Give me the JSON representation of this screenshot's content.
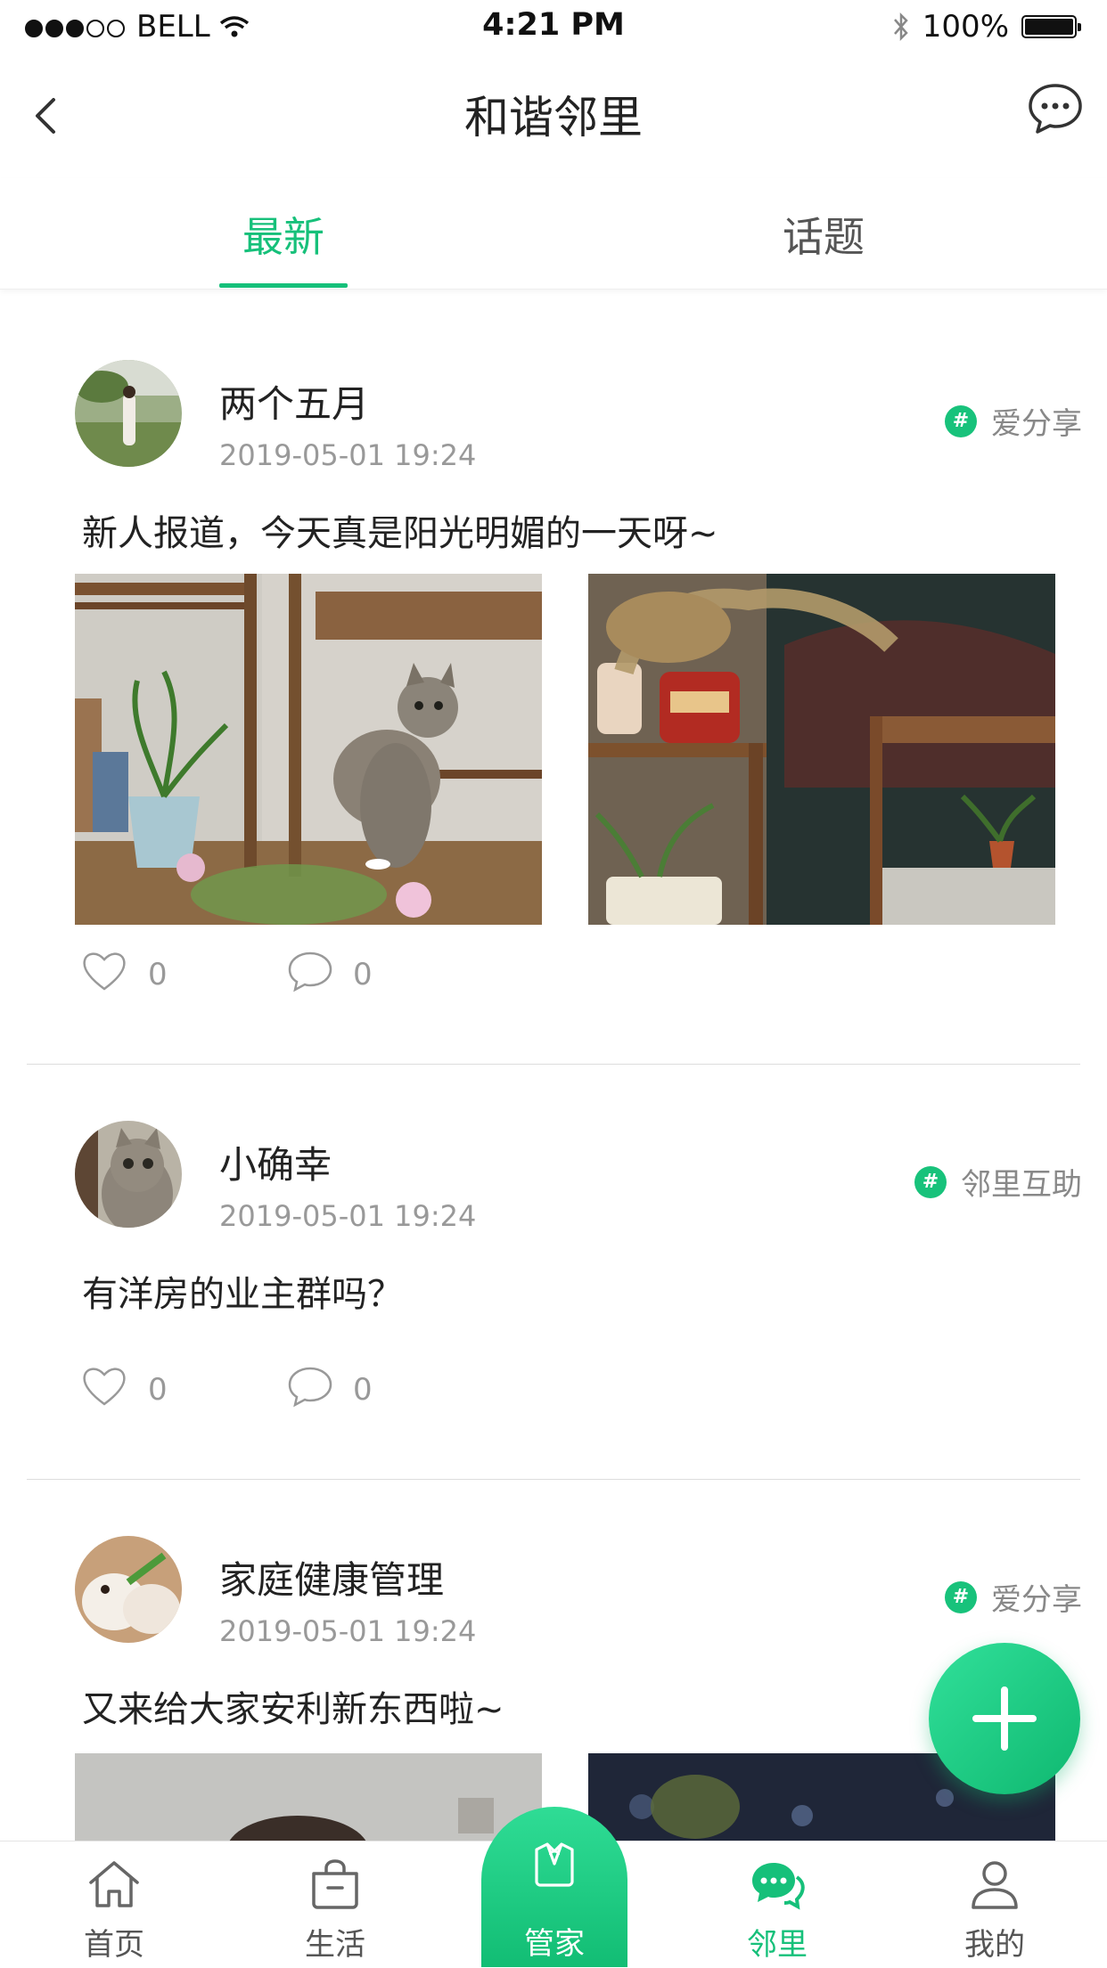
{
  "status_bar": {
    "carrier": "BELL",
    "time": "4:21 PM",
    "battery": "100%"
  },
  "nav": {
    "title": "和谐邻里",
    "back_icon": "chevron-left-icon",
    "message_icon": "chat-bubble-icon"
  },
  "tabs": [
    {
      "label": "最新",
      "active": true
    },
    {
      "label": "话题",
      "active": false
    }
  ],
  "posts": [
    {
      "username": "两个五月",
      "time": "2019-05-01   19:24",
      "topic": "爱分享",
      "content": "新人报道，今天真是阳光明媚的一天呀~",
      "likes": "0",
      "comments": "0"
    },
    {
      "username": "小确幸",
      "time": "2019-05-01   19:24",
      "topic": "邻里互助",
      "content": "有洋房的业主群吗？",
      "likes": "0",
      "comments": "0"
    },
    {
      "username": "家庭健康管理",
      "time": "2019-05-01   19:24",
      "topic": "爱分享",
      "content": "又来给大家安利新东西啦~",
      "likes": "",
      "comments": ""
    }
  ],
  "tabbar": {
    "items": [
      {
        "label": "首页",
        "icon": "home-icon"
      },
      {
        "label": "生活",
        "icon": "shopping-bag-icon"
      },
      {
        "label": "管家",
        "icon": "butler-icon"
      },
      {
        "label": "邻里",
        "icon": "neighbors-chat-icon"
      },
      {
        "label": "我的",
        "icon": "person-icon"
      }
    ],
    "active": "邻里"
  },
  "colors": {
    "accent": "#16c07a",
    "text": "#222222",
    "muted": "#999999"
  }
}
